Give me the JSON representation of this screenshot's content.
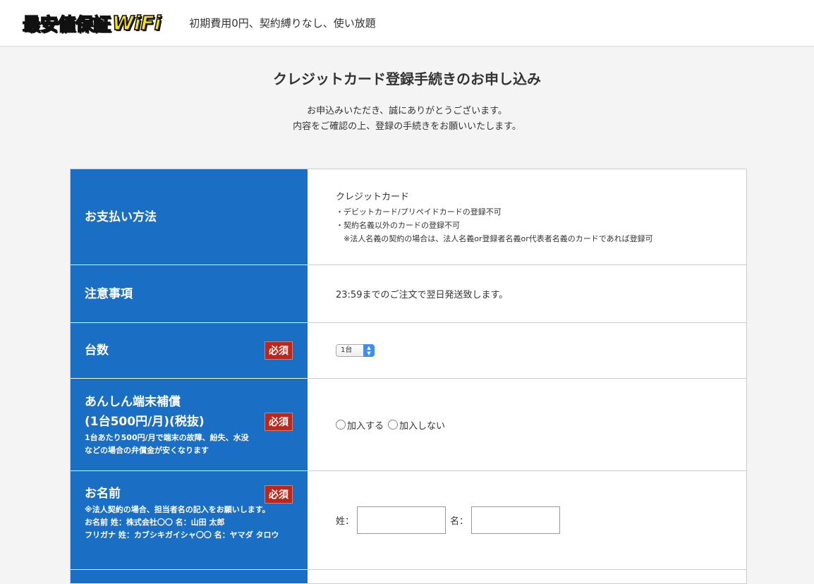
{
  "header": {
    "logo_text": "最安値保証",
    "logo_wifi": "WiFi",
    "tagline": "初期費用0円、契約縛りなし、使い放題"
  },
  "page": {
    "title": "クレジットカード登録手続きのお申し込み",
    "intro_line1": "お申込みいただき、誠にありがとうございます。",
    "intro_line2": "内容をご確認の上、登録の手続きをお願いいたします。"
  },
  "form": {
    "required_label": "必須",
    "payment": {
      "label": "お支払い方法",
      "title": "クレジットカード",
      "lines": [
        "・デビットカード/プリペイドカードの登録不可",
        "・契約名義以外のカードの登録不可",
        "　※法人名義の契約の場合は、法人名義or登録者名義or代表者名義のカードであれば登録可"
      ]
    },
    "notice": {
      "label": "注意事項",
      "text": "23:59までのご注文で翌日発送致します。"
    },
    "quantity": {
      "label": "台数",
      "selected": "1台"
    },
    "insurance": {
      "label_line1": "あんしん端末補償",
      "label_line2": "(1台500円/月)(税抜)",
      "sub_line1": "1台あたり500円/月で端末の故障、紛失、水没",
      "sub_line2": "などの場合の弁償金が安くなります",
      "options": [
        "加入する",
        "加入しない"
      ]
    },
    "name": {
      "label": "お名前",
      "sub_line1": "※法人契約の場合、担当者名の記入をお願いします。",
      "sub_line2": "お名前 姓：株式会社〇〇 名：山田 太郎",
      "sub_line3": "フリガナ 姓：カブシキガイシャ〇〇 名：ヤマダ タロウ",
      "last_label": "姓：",
      "first_label": "名：",
      "last_value": "",
      "first_value": ""
    }
  }
}
